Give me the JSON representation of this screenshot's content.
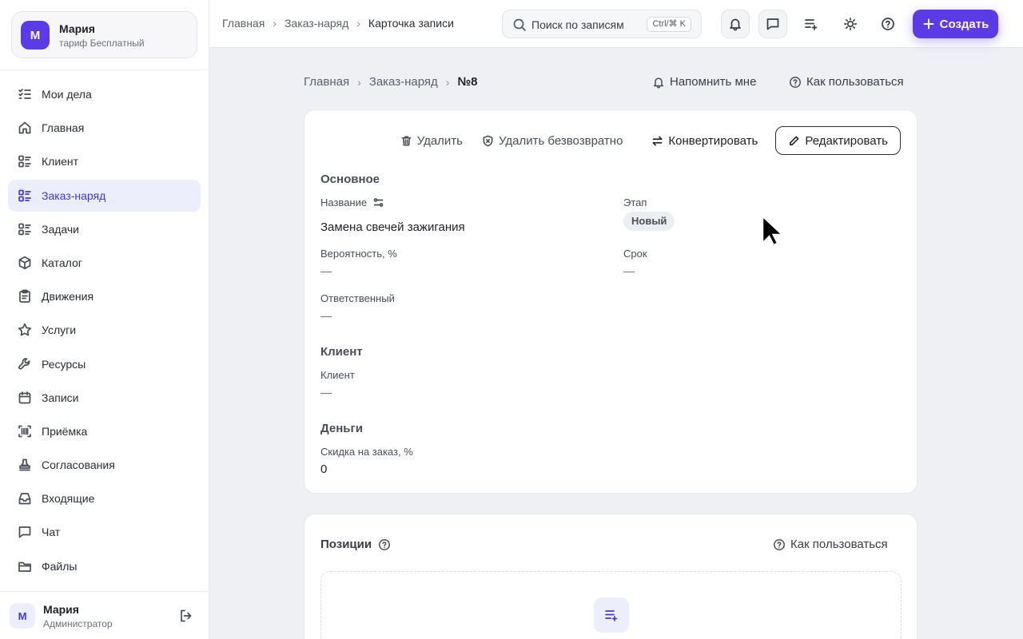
{
  "account": {
    "initial": "М",
    "name": "Мария",
    "plan": "тариф Бесплатный"
  },
  "sidebar": {
    "items": [
      {
        "label": "Мои дела",
        "icon": "list-check-icon"
      },
      {
        "label": "Главная",
        "icon": "home-icon"
      },
      {
        "label": "Клиент",
        "icon": "list-grid-icon"
      },
      {
        "label": "Заказ-наряд",
        "icon": "list-grid-icon",
        "active": true
      },
      {
        "label": "Задачи",
        "icon": "list-grid-icon"
      },
      {
        "label": "Каталог",
        "icon": "box-icon"
      },
      {
        "label": "Движения",
        "icon": "clipboard-icon"
      },
      {
        "label": "Услуги",
        "icon": "star-icon"
      },
      {
        "label": "Ресурсы",
        "icon": "wrench-icon"
      },
      {
        "label": "Записи",
        "icon": "calendar-icon"
      },
      {
        "label": "Приёмка",
        "icon": "barcode-icon"
      },
      {
        "label": "Согласования",
        "icon": "stamp-icon"
      },
      {
        "label": "Входящие",
        "icon": "inbox-icon"
      },
      {
        "label": "Чат",
        "icon": "chat-icon"
      },
      {
        "label": "Файлы",
        "icon": "folder-icon"
      }
    ]
  },
  "user": {
    "initial": "М",
    "name": "Мария",
    "role": "Администратор"
  },
  "topbar": {
    "breadcrumb": [
      "Главная",
      "Заказ-наряд",
      "Карточка записи"
    ],
    "search_placeholder": "Поиск по записям",
    "search_shortcut": "Ctrl/⌘ K",
    "create_label": "Создать"
  },
  "page": {
    "breadcrumb": [
      "Главная",
      "Заказ-наряд",
      "№8"
    ],
    "remind_label": "Напомнить мне",
    "howto_label": "Как пользоваться"
  },
  "record": {
    "actions": {
      "delete": "Удалить",
      "delete_forever": "Удалить безвозвратно",
      "convert": "Конвертировать",
      "edit": "Редактировать"
    },
    "sections": {
      "main": "Основное",
      "client": "Клиент",
      "money": "Деньги"
    },
    "fields": {
      "name_label": "Название",
      "name_value": "Замена свечей зажигания",
      "stage_label": "Этап",
      "stage_value": "Новый",
      "probability_label": "Вероятность, %",
      "probability_value": "—",
      "deadline_label": "Срок",
      "deadline_value": "—",
      "responsible_label": "Ответственный",
      "responsible_value": "—",
      "client_label": "Клиент",
      "client_value": "—",
      "discount_label": "Скидка на заказ, %",
      "discount_value": "0"
    }
  },
  "positions": {
    "title": "Позиции",
    "howto_label": "Как пользоваться"
  },
  "colors": {
    "accent": "#5b3be6",
    "active_bg": "#eceefc",
    "page_bg": "#eef0f4"
  }
}
